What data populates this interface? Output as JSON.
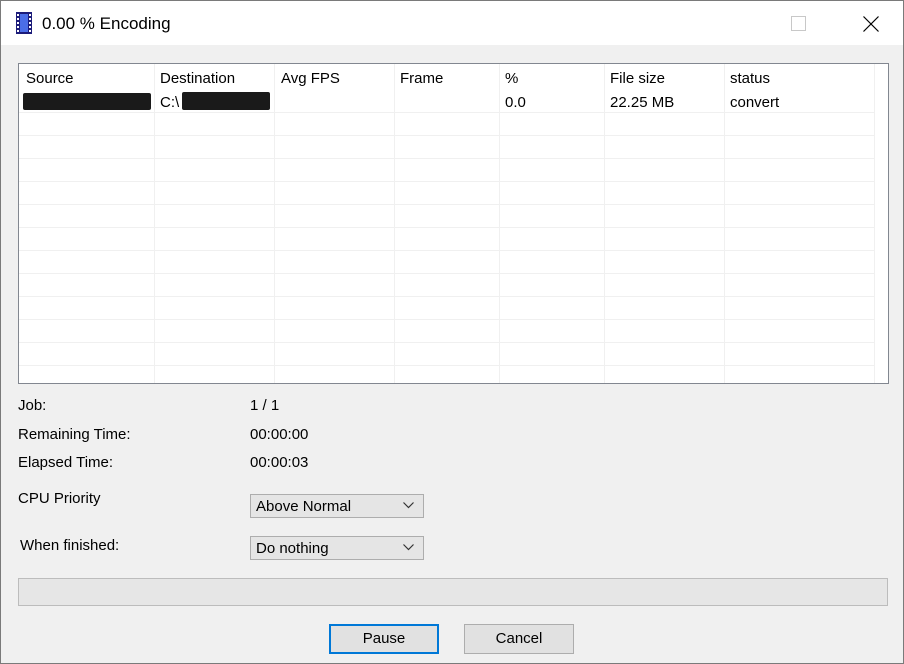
{
  "window": {
    "title": "0.00 % Encoding",
    "icon": "film-strip-icon"
  },
  "list": {
    "columns": [
      "Source",
      "Destination",
      "Avg FPS",
      "Frame",
      "%",
      "File size",
      "status"
    ],
    "rows": [
      {
        "source": "",
        "destination": "C:\\",
        "avg_fps": "",
        "frame": "",
        "percent": "0.0",
        "file_size": "22.25 MB",
        "status": "convert"
      }
    ]
  },
  "info": {
    "job_label": "Job:",
    "job_value": "1 / 1",
    "remaining_label": "Remaining Time:",
    "remaining_value": "00:00:00",
    "elapsed_label": "Elapsed Time:",
    "elapsed_value": "00:00:03",
    "cpu_label": "CPU Priority",
    "cpu_value": "Above Normal",
    "finished_label": "When finished:",
    "finished_value": "Do nothing"
  },
  "progress": {
    "value": 0
  },
  "buttons": {
    "pause": "Pause",
    "cancel": "Cancel"
  }
}
